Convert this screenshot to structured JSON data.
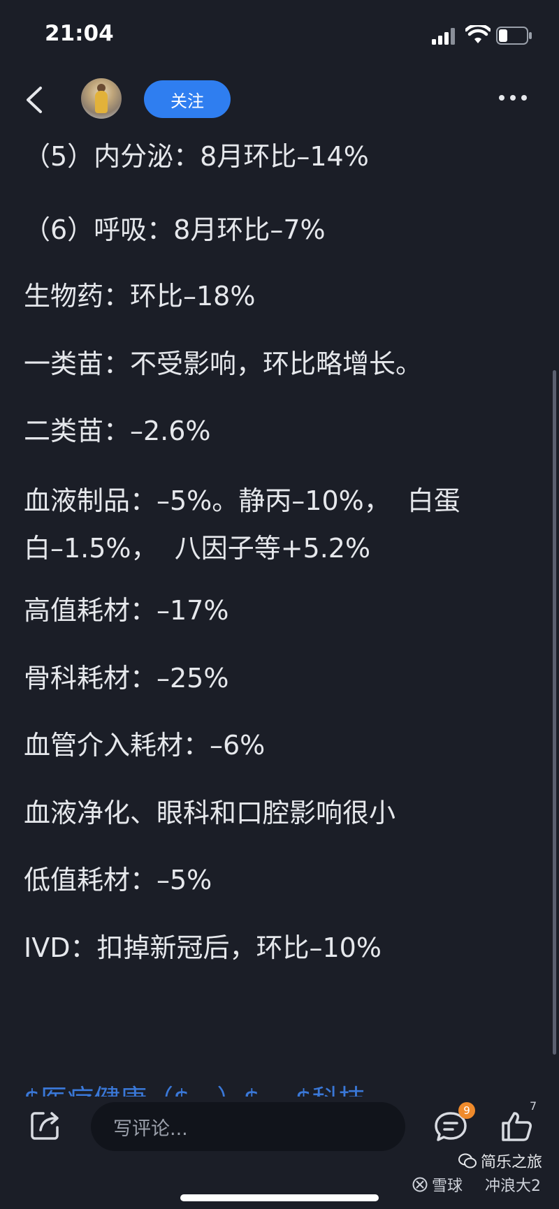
{
  "status_bar": {
    "time": "21:04"
  },
  "nav": {
    "follow_label": "关注"
  },
  "content": {
    "paragraphs": [
      "（5）内分泌：8月环比–14%",
      "（6）呼吸：8月环比–7%",
      "生物药：环比–18%",
      "一类苗：不受影响，环比略增长。",
      "二类苗：–2.6%",
      "血液制品：–5%。静丙–10%，  白蛋\n白–1.5%，  八因子等+5.2%",
      "高值耗材：–17%",
      "骨科耗材：–25%",
      "血管介入耗材：–6%",
      "血液净化、眼科和口腔影响很小",
      "低值耗材：–5%",
      "IVD：扣掉新冠后，环比–10%"
    ],
    "partial_link": "$医疗健康（$…）$ …$科技"
  },
  "bottom_bar": {
    "comment_placeholder": "写评论...",
    "comment_badge": "9",
    "like_count": "7"
  },
  "watermark": {
    "left": "雪球",
    "right": "简乐之旅",
    "sub": "冲浪大2"
  },
  "colors": {
    "background": "#1b1e27",
    "accent": "#2f7ef0",
    "badge": "#ef8a2b",
    "link": "#3a78d8"
  }
}
